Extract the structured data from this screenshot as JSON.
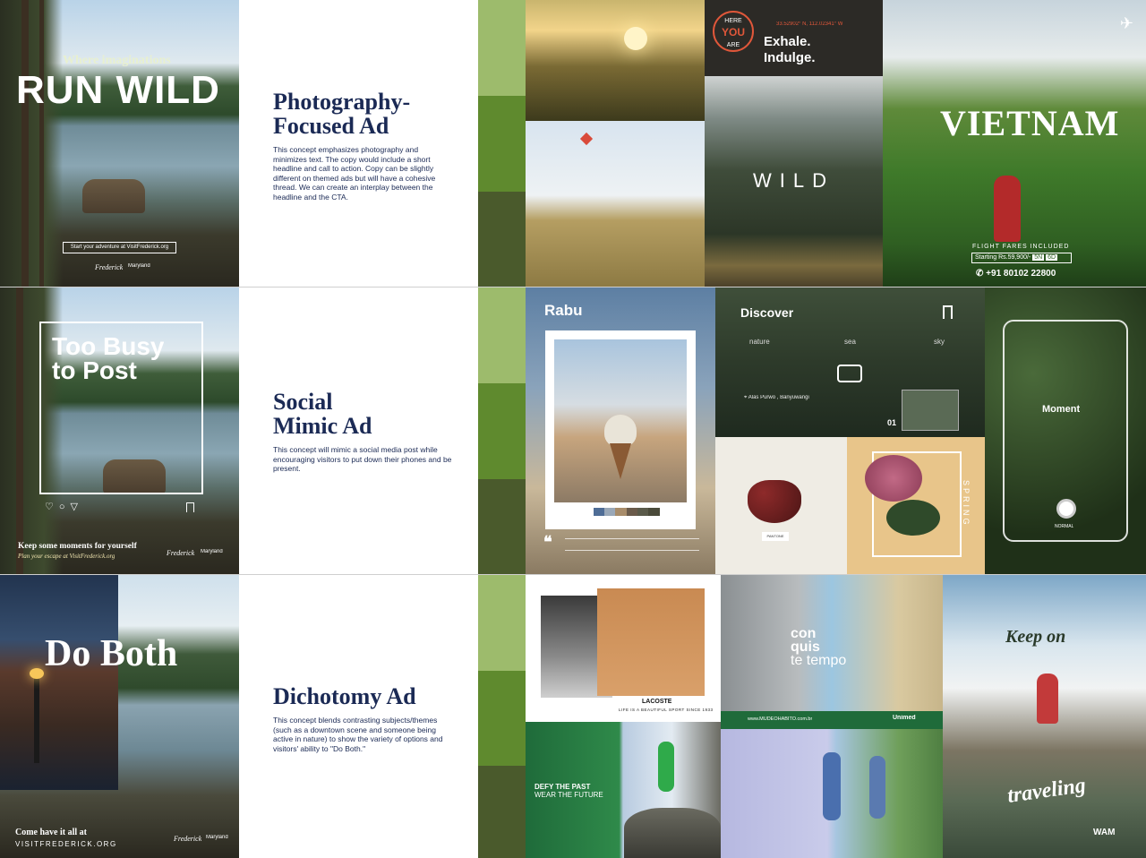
{
  "rows": [
    {
      "hero": {
        "pre_headline": "Where imaginations",
        "headline": "RUN WILD",
        "cta": "Start your adventure at VisitFrederick.org",
        "logo1": "Frederick",
        "logo2": "Maryland"
      },
      "panel": {
        "title_line1": "Photography-",
        "title_line2": "Focused Ad",
        "body": "This concept emphasizes photography and minimizes text. The copy would include a short headline and call to action. Copy can be slightly different on themed ads but will have a cohesive thread. We can create an interplay between the headline and the CTA."
      },
      "swatches": [
        "#9dbb6c",
        "#5f8a2e",
        "#4a5a2c"
      ],
      "moodboard": {
        "badge_line1": "HERE",
        "badge_line2": "YOU",
        "badge_line3": "ARE",
        "coords": "33.52902° N, 112.02341° W",
        "exhale_line1": "Exhale.",
        "exhale_line2": "Indulge.",
        "wild": "WILD",
        "vietnam": "VIETNAM",
        "flight_fares": "FLIGHT FARES INCLUDED",
        "starting": "Starting Rs.59,900/-",
        "nights": "5N",
        "days": "6D",
        "phone": "+91 80102 22800"
      }
    },
    {
      "hero": {
        "headline_line1": "Too Busy",
        "headline_line2": "to Post",
        "tagline": "Keep some moments for yourself",
        "cta": "Plan your escape at VisitFrederick.org",
        "logo1": "Frederick",
        "logo2": "Maryland"
      },
      "panel": {
        "title_line1": "Social",
        "title_line2": "Mimic Ad",
        "body": "This concept will mimic a social media post while encouraging visitors to put down their phones and be present."
      },
      "swatches": [
        "#9dbb6c",
        "#5f8a2e",
        "#4a5a2c"
      ],
      "moodboard": {
        "rabu": "Rabu",
        "discover": "Discover",
        "tab1": "nature",
        "tab2": "sea",
        "tab3": "sky",
        "location": "Alas Purwo , Banyuwangi",
        "counter": "01",
        "pantone": "PANTONE",
        "spring": "SPRING",
        "moment": "Moment",
        "mode": "NORMAL",
        "quote_marks": "❝"
      }
    },
    {
      "hero": {
        "headline": "Do Both",
        "tagline": "Come have it all at",
        "url": "VISITFREDERICK.ORG",
        "logo1": "Frederick",
        "logo2": "Maryland"
      },
      "panel": {
        "title": "Dichotomy Ad",
        "body": "This concept blends contrasting subjects/themes (such as a downtown scene and someone being active in nature) to show the variety of options and visitors' ability to \"Do Both.\""
      },
      "swatches": [
        "#9dbb6c",
        "#5f8a2e",
        "#4a5a2c"
      ],
      "moodboard": {
        "lacoste": "LACOSTE",
        "lacoste_tag": "LIFE IS A BEAUTIFUL SPORT SINCE 1933",
        "conquis_line1": "con",
        "conquis_line2": "quis",
        "conquis_line3": "te tempo",
        "mude": "www.MUDEOHABITO.com.br",
        "unimed": "Unimed",
        "defy_line1": "DEFY THE PAST",
        "defy_line2": "WEAR THE FUTURE",
        "keep_on": "Keep on",
        "traveling": "traveling",
        "wam": "WAM"
      }
    }
  ]
}
